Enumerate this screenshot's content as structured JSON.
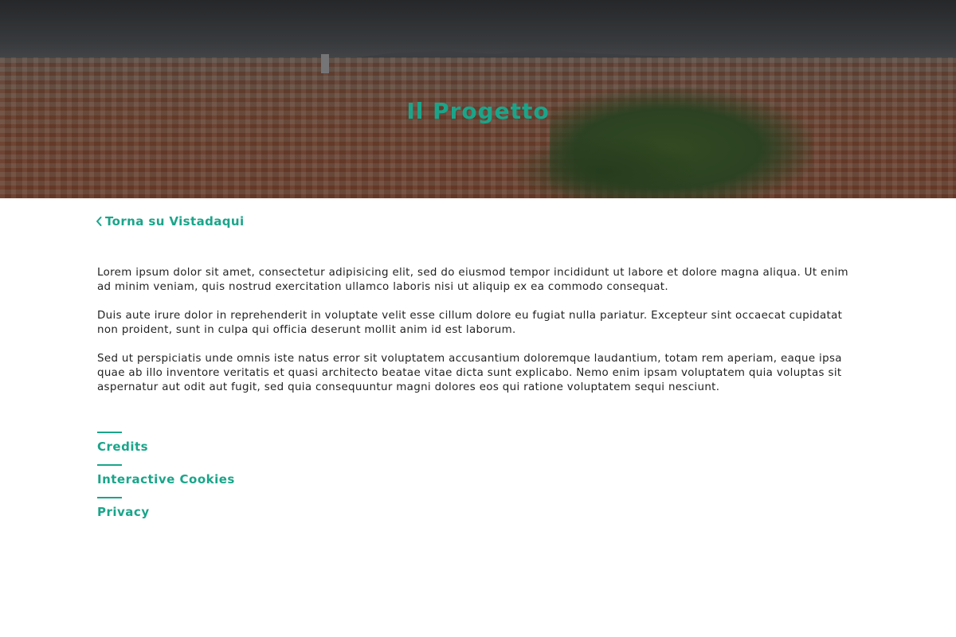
{
  "hero": {
    "title": "Il Progetto",
    "image_description_icon": "city-panorama-image"
  },
  "nav": {
    "back_label": "Torna su Vistadaqui",
    "back_icon": "chevron-left-icon"
  },
  "content": {
    "paragraphs": [
      "Lorem ipsum dolor sit amet, consectetur adipisicing elit, sed do eiusmod tempor incididunt ut labore et dolore magna aliqua. Ut enim ad minim veniam, quis nostrud exercitation ullamco laboris nisi ut aliquip ex ea commodo consequat.",
      "Duis aute irure dolor in reprehenderit in voluptate velit esse cillum dolore eu fugiat nulla pariatur. Excepteur sint occaecat cupidatat non proident, sunt in culpa qui officia deserunt mollit anim id est laborum.",
      "Sed ut perspiciatis unde omnis iste natus error sit voluptatem accusantium doloremque laudantium, totam rem aperiam, eaque ipsa quae ab illo inventore veritatis et quasi architecto beatae vitae dicta sunt explicabo. Nemo enim ipsam voluptatem quia voluptas sit aspernatur aut odit aut fugit, sed quia consequuntur magni dolores eos qui ratione voluptatem sequi nesciunt."
    ]
  },
  "footer": {
    "links": [
      {
        "label": "Credits"
      },
      {
        "label": "Interactive Cookies"
      },
      {
        "label": "Privacy"
      }
    ]
  },
  "colors": {
    "accent": "#1aa58a",
    "text": "#222222",
    "background": "#ffffff"
  }
}
